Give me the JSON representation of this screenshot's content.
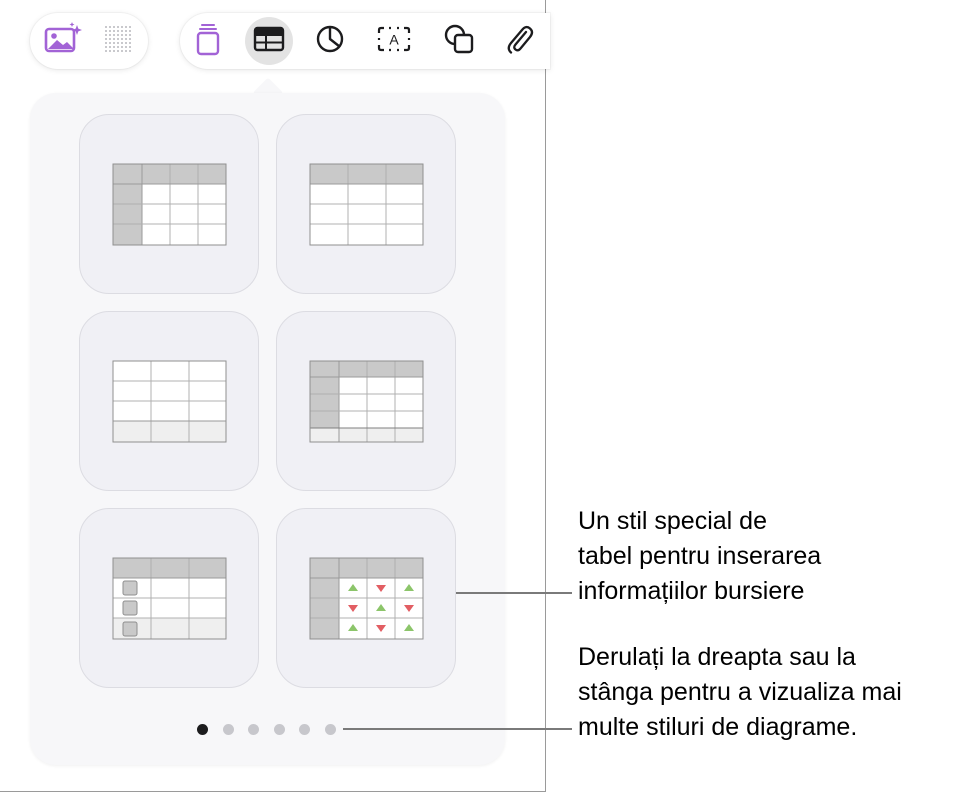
{
  "toolbar": {
    "left_icons": [
      "photo-sparkle-icon",
      "dot-grid-icon"
    ],
    "tabs": [
      {
        "icon": "document-stack-icon",
        "selected": false
      },
      {
        "icon": "table-icon",
        "selected": true
      },
      {
        "icon": "pie-chart-icon",
        "selected": false
      },
      {
        "icon": "text-box-icon",
        "selected": false,
        "glyph": "A"
      },
      {
        "icon": "shapes-icon",
        "selected": false
      },
      {
        "icon": "paperclip-icon",
        "selected": false
      }
    ],
    "accent_color": "#a263d6"
  },
  "table_styles": [
    {
      "name": "header-row-and-column"
    },
    {
      "name": "header-row"
    },
    {
      "name": "plain"
    },
    {
      "name": "header-row-column-footer"
    },
    {
      "name": "checklist"
    },
    {
      "name": "stock"
    }
  ],
  "pagination": {
    "total": 6,
    "current": 1
  },
  "callouts": {
    "stock_table": "Un stil special de\ntabel pentru inserarea\ninformațiilor bursiere",
    "scroll_hint": "Derulați la dreapta sau la\nstânga pentru a vizualiza mai\nmulte stiluri de diagrame."
  },
  "colors": {
    "up_arrow": "#8cc56a",
    "down_arrow": "#e25e63",
    "header_fill": "#c9c9c9"
  }
}
